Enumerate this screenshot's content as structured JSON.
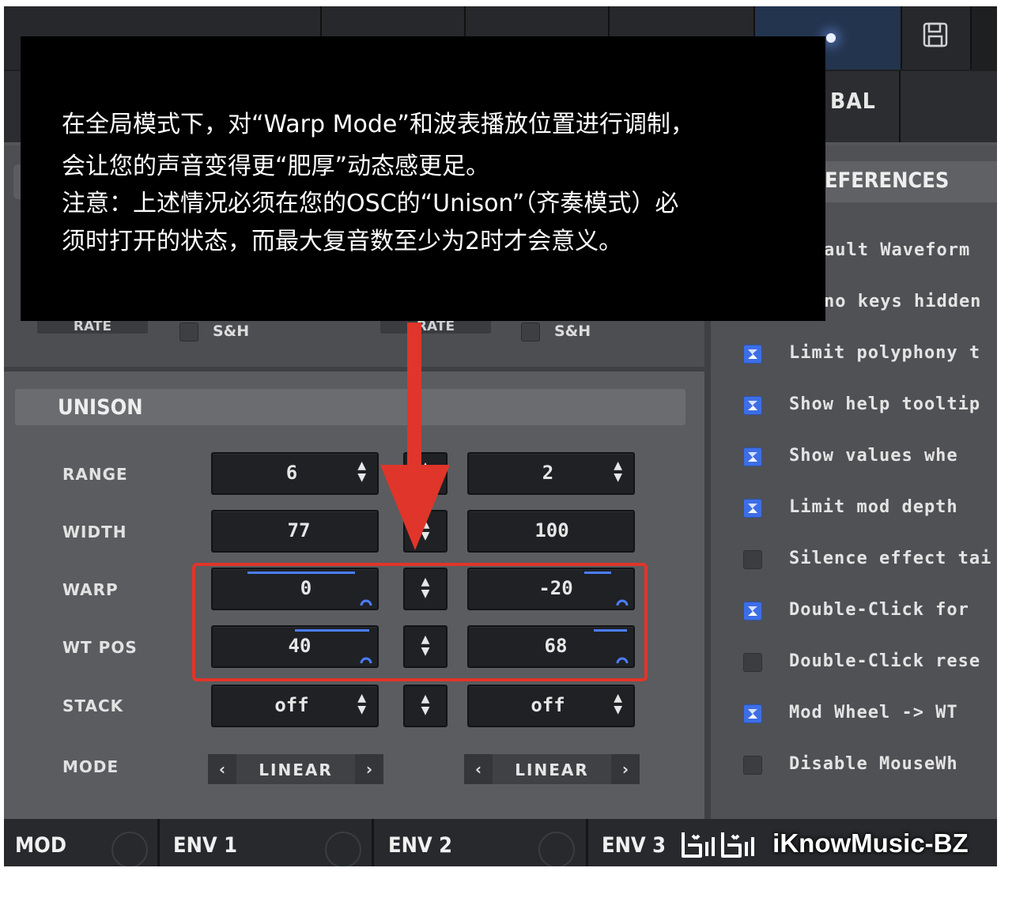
{
  "tooltip": {
    "lines": [
      "在全局模式下，对“Warp Mode”和波表播放位置进行调制，",
      "会让您的声音变得更“肥厚”动态感更足。",
      "注意：上述情况必须在您的OSC的“Unison”（齐奏模式）必",
      "须时打开的状态，而最大复音数至少为2时才会意义。"
    ]
  },
  "topbar": {
    "global_label": "BAL"
  },
  "lfo": {
    "rate_left": "RATE",
    "rate_right": "RATE",
    "sh_left": "S&H",
    "sh_right": "S&H"
  },
  "unison": {
    "title": "UNISON",
    "rows": [
      {
        "label": "RANGE",
        "left": "6",
        "right": "2"
      },
      {
        "label": "WIDTH",
        "left": "77",
        "right": "100"
      },
      {
        "label": "WARP",
        "left": "0",
        "right": "-20"
      },
      {
        "label": "WT POS",
        "left": "40",
        "right": "68"
      },
      {
        "label": "STACK",
        "left": "off",
        "right": "off"
      },
      {
        "label": "MODE",
        "left": "LINEAR",
        "right": "LINEAR"
      }
    ]
  },
  "preferences": {
    "title": "EFERENCES",
    "items": [
      {
        "label": "ault Waveform",
        "checked": null
      },
      {
        "label": "no keys hidden",
        "checked": null
      },
      {
        "label": "Limit polyphony t",
        "checked": true
      },
      {
        "label": "Show help tooltip",
        "checked": true
      },
      {
        "label": "Show values whe",
        "checked": true
      },
      {
        "label": "Limit mod depth",
        "checked": true
      },
      {
        "label": "Silence effect tai",
        "checked": false
      },
      {
        "label": "Double-Click for",
        "checked": true
      },
      {
        "label": "Double-Click rese",
        "checked": false
      },
      {
        "label": "Mod Wheel -> WT",
        "checked": true
      },
      {
        "label": "Disable MouseWh",
        "checked": false
      }
    ]
  },
  "bottom_tabs": [
    "MOD",
    "ENV 1",
    "ENV 2",
    "ENV 3"
  ],
  "watermark": "iKnowMusic-BZ",
  "colors": {
    "accent": "#3d6ee6",
    "highlight": "#e0352a",
    "mod_bar": "#4b7dff"
  },
  "icons": [
    "save-icon",
    "up-down-arrows-icon",
    "chevron-left-icon",
    "chevron-right-icon",
    "checkbox-icon",
    "bilibili-logo"
  ]
}
